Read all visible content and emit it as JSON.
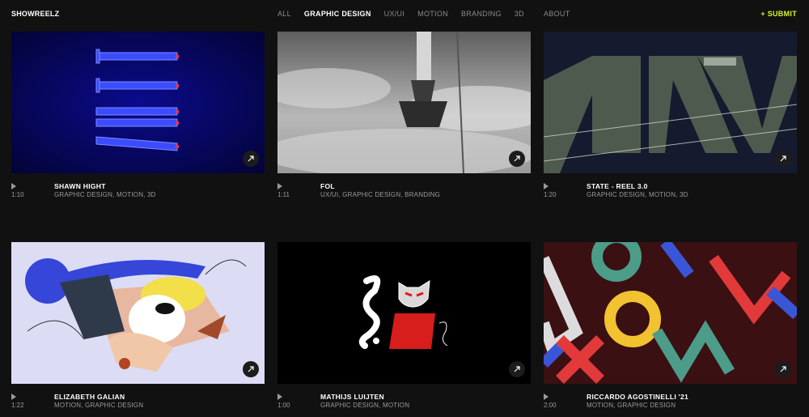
{
  "brand": "SHOWREELZ",
  "nav": {
    "items": [
      {
        "label": "ALL",
        "active": false
      },
      {
        "label": "GRAPHIC DESIGN",
        "active": true
      },
      {
        "label": "UX/UI",
        "active": false
      },
      {
        "label": "MOTION",
        "active": false
      },
      {
        "label": "BRANDING",
        "active": false
      },
      {
        "label": "3D",
        "active": false
      }
    ],
    "about": "ABOUT",
    "submit": "+ SUBMIT"
  },
  "colors": {
    "background": "#111111",
    "accent": "#d4f52a",
    "muted": "#8a8a8a"
  },
  "cards": [
    {
      "title": "SHAWN HIGHT",
      "tags": "GRAPHIC DESIGN, MOTION, 3D",
      "duration": "1:10",
      "open_icon": "arrow-up-right-icon"
    },
    {
      "title": "FOL",
      "tags": "UX/UI, GRAPHIC DESIGN, BRANDING",
      "duration": "1:11",
      "open_icon": "arrow-up-right-icon"
    },
    {
      "title": "STATE - REEL 3.0",
      "tags": "GRAPHIC DESIGN, MOTION, 3D",
      "duration": "1:20",
      "open_icon": "arrow-up-right-icon"
    },
    {
      "title": "ELIZABETH GALIAN",
      "tags": "MOTION, GRAPHIC DESIGN",
      "duration": "1:22",
      "open_icon": "arrow-up-right-icon"
    },
    {
      "title": "MATHIJS LUIJTEN",
      "tags": "GRAPHIC DESIGN, MOTION",
      "duration": "1:00",
      "open_icon": "arrow-up-right-icon"
    },
    {
      "title": "RICCARDO AGOSTINELLI '21",
      "tags": "MOTION, GRAPHIC DESIGN",
      "duration": "2:00",
      "open_icon": "arrow-up-right-icon"
    }
  ]
}
